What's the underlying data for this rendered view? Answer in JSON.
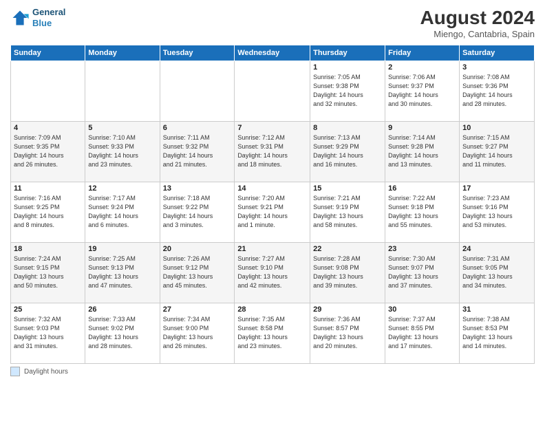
{
  "header": {
    "logo_line1": "General",
    "logo_line2": "Blue",
    "month_year": "August 2024",
    "location": "Miengo, Cantabria, Spain"
  },
  "days_of_week": [
    "Sunday",
    "Monday",
    "Tuesday",
    "Wednesday",
    "Thursday",
    "Friday",
    "Saturday"
  ],
  "weeks": [
    [
      {
        "day": "",
        "info": ""
      },
      {
        "day": "",
        "info": ""
      },
      {
        "day": "",
        "info": ""
      },
      {
        "day": "",
        "info": ""
      },
      {
        "day": "1",
        "info": "Sunrise: 7:05 AM\nSunset: 9:38 PM\nDaylight: 14 hours\nand 32 minutes."
      },
      {
        "day": "2",
        "info": "Sunrise: 7:06 AM\nSunset: 9:37 PM\nDaylight: 14 hours\nand 30 minutes."
      },
      {
        "day": "3",
        "info": "Sunrise: 7:08 AM\nSunset: 9:36 PM\nDaylight: 14 hours\nand 28 minutes."
      }
    ],
    [
      {
        "day": "4",
        "info": "Sunrise: 7:09 AM\nSunset: 9:35 PM\nDaylight: 14 hours\nand 26 minutes."
      },
      {
        "day": "5",
        "info": "Sunrise: 7:10 AM\nSunset: 9:33 PM\nDaylight: 14 hours\nand 23 minutes."
      },
      {
        "day": "6",
        "info": "Sunrise: 7:11 AM\nSunset: 9:32 PM\nDaylight: 14 hours\nand 21 minutes."
      },
      {
        "day": "7",
        "info": "Sunrise: 7:12 AM\nSunset: 9:31 PM\nDaylight: 14 hours\nand 18 minutes."
      },
      {
        "day": "8",
        "info": "Sunrise: 7:13 AM\nSunset: 9:29 PM\nDaylight: 14 hours\nand 16 minutes."
      },
      {
        "day": "9",
        "info": "Sunrise: 7:14 AM\nSunset: 9:28 PM\nDaylight: 14 hours\nand 13 minutes."
      },
      {
        "day": "10",
        "info": "Sunrise: 7:15 AM\nSunset: 9:27 PM\nDaylight: 14 hours\nand 11 minutes."
      }
    ],
    [
      {
        "day": "11",
        "info": "Sunrise: 7:16 AM\nSunset: 9:25 PM\nDaylight: 14 hours\nand 8 minutes."
      },
      {
        "day": "12",
        "info": "Sunrise: 7:17 AM\nSunset: 9:24 PM\nDaylight: 14 hours\nand 6 minutes."
      },
      {
        "day": "13",
        "info": "Sunrise: 7:18 AM\nSunset: 9:22 PM\nDaylight: 14 hours\nand 3 minutes."
      },
      {
        "day": "14",
        "info": "Sunrise: 7:20 AM\nSunset: 9:21 PM\nDaylight: 14 hours\nand 1 minute."
      },
      {
        "day": "15",
        "info": "Sunrise: 7:21 AM\nSunset: 9:19 PM\nDaylight: 13 hours\nand 58 minutes."
      },
      {
        "day": "16",
        "info": "Sunrise: 7:22 AM\nSunset: 9:18 PM\nDaylight: 13 hours\nand 55 minutes."
      },
      {
        "day": "17",
        "info": "Sunrise: 7:23 AM\nSunset: 9:16 PM\nDaylight: 13 hours\nand 53 minutes."
      }
    ],
    [
      {
        "day": "18",
        "info": "Sunrise: 7:24 AM\nSunset: 9:15 PM\nDaylight: 13 hours\nand 50 minutes."
      },
      {
        "day": "19",
        "info": "Sunrise: 7:25 AM\nSunset: 9:13 PM\nDaylight: 13 hours\nand 47 minutes."
      },
      {
        "day": "20",
        "info": "Sunrise: 7:26 AM\nSunset: 9:12 PM\nDaylight: 13 hours\nand 45 minutes."
      },
      {
        "day": "21",
        "info": "Sunrise: 7:27 AM\nSunset: 9:10 PM\nDaylight: 13 hours\nand 42 minutes."
      },
      {
        "day": "22",
        "info": "Sunrise: 7:28 AM\nSunset: 9:08 PM\nDaylight: 13 hours\nand 39 minutes."
      },
      {
        "day": "23",
        "info": "Sunrise: 7:30 AM\nSunset: 9:07 PM\nDaylight: 13 hours\nand 37 minutes."
      },
      {
        "day": "24",
        "info": "Sunrise: 7:31 AM\nSunset: 9:05 PM\nDaylight: 13 hours\nand 34 minutes."
      }
    ],
    [
      {
        "day": "25",
        "info": "Sunrise: 7:32 AM\nSunset: 9:03 PM\nDaylight: 13 hours\nand 31 minutes."
      },
      {
        "day": "26",
        "info": "Sunrise: 7:33 AM\nSunset: 9:02 PM\nDaylight: 13 hours\nand 28 minutes."
      },
      {
        "day": "27",
        "info": "Sunrise: 7:34 AM\nSunset: 9:00 PM\nDaylight: 13 hours\nand 26 minutes."
      },
      {
        "day": "28",
        "info": "Sunrise: 7:35 AM\nSunset: 8:58 PM\nDaylight: 13 hours\nand 23 minutes."
      },
      {
        "day": "29",
        "info": "Sunrise: 7:36 AM\nSunset: 8:57 PM\nDaylight: 13 hours\nand 20 minutes."
      },
      {
        "day": "30",
        "info": "Sunrise: 7:37 AM\nSunset: 8:55 PM\nDaylight: 13 hours\nand 17 minutes."
      },
      {
        "day": "31",
        "info": "Sunrise: 7:38 AM\nSunset: 8:53 PM\nDaylight: 13 hours\nand 14 minutes."
      }
    ]
  ],
  "footer": {
    "legend_label": "Daylight hours"
  }
}
